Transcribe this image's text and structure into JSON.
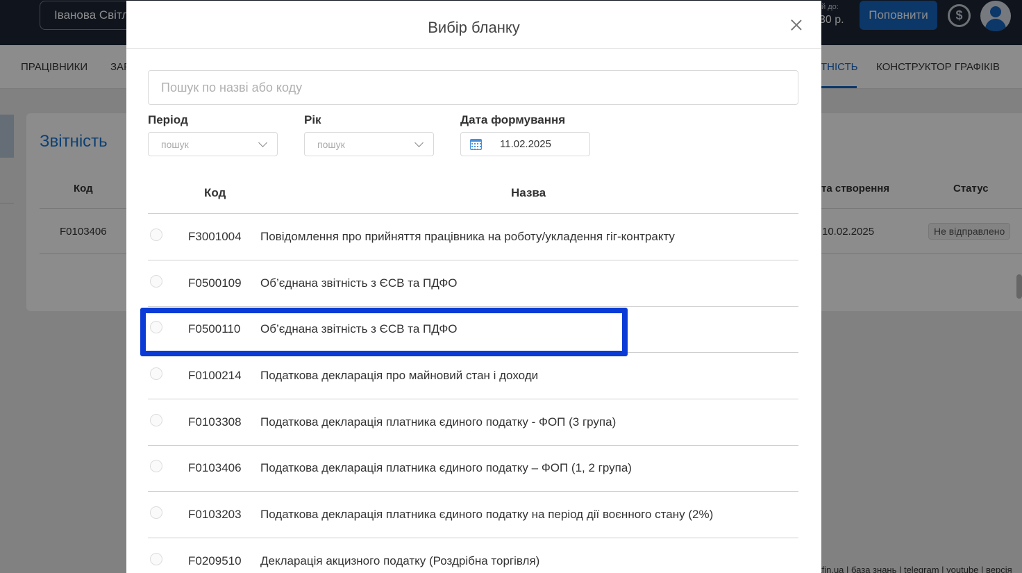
{
  "topbar": {
    "user": "Іванова Світлана",
    "balance_line1": "й до:",
    "balance_line2": "30 р.",
    "topup_label": "Поповнити",
    "dollar_icon": "dollar-circle-icon",
    "avatar_icon": "user-avatar-icon"
  },
  "nav": {
    "items": [
      "ПРАЦІВНИКИ",
      "ЗАР",
      "ТНІСТЬ",
      "КОНСТРУКТОР ГРАФІКІВ"
    ],
    "active_index": 2
  },
  "page": {
    "title": "Звітність",
    "columns": [
      "Код",
      "та створення",
      "Статус"
    ],
    "rows": [
      {
        "code": "F0103406",
        "created": "10.02.2025",
        "status": "Не відправлено"
      }
    ],
    "footer": "tfin.ua | база знань | telegram | youtube | версія"
  },
  "modal": {
    "title": "Вибір бланку",
    "close_icon": "close-icon",
    "search_placeholder": "Пошук по назві або коду",
    "period_label": "Період",
    "period_placeholder": "пошук",
    "year_label": "Рік",
    "year_placeholder": "пошук",
    "date_label": "Дата формування",
    "date_value": "11.02.2025",
    "calendar_icon": "calendar-icon",
    "col_code": "Код",
    "col_name": "Назва",
    "forms": [
      {
        "code": "F3001004",
        "name": "Повідомлення про прийняття працівника на роботу/укладення гіг-контракту"
      },
      {
        "code": "F0500109",
        "name": "Об’єднана звітність з ЄСВ та ПДФО"
      },
      {
        "code": "F0500110",
        "name": "Об’єднана звітність з ЄСВ та ПДФО"
      },
      {
        "code": "F0100214",
        "name": "Податкова декларація про майновий стан і доходи"
      },
      {
        "code": "F0103308",
        "name": "Податкова декларація платника єдиного податку - ФОП (3 група)"
      },
      {
        "code": "F0103406",
        "name": "Податкова декларація платника єдиного податку – ФОП (1, 2 група)"
      },
      {
        "code": "F0103203",
        "name": "Податкова декларація платника єдиного податку на період дії воєнного стану (2%)"
      },
      {
        "code": "F0209510",
        "name": "Декларація акцизного податку (Роздрібна торгівля)"
      }
    ],
    "highlighted_index": 2,
    "highlight_color": "#0a3bd6"
  }
}
